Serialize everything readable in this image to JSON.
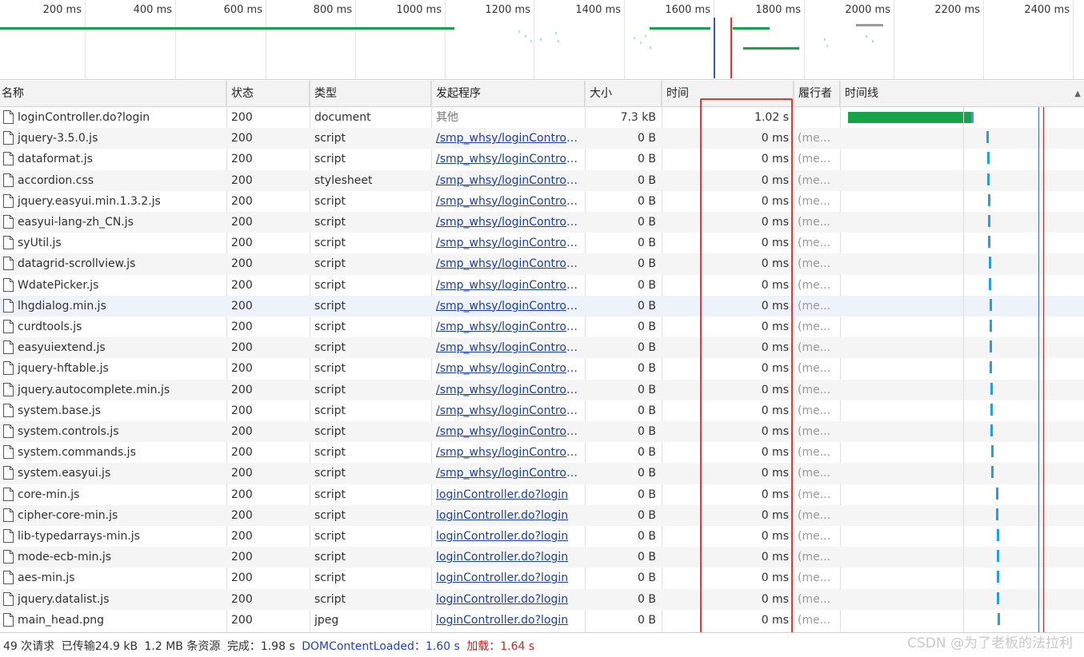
{
  "overview": {
    "ticks": [
      "200 ms",
      "400 ms",
      "600 ms",
      "800 ms",
      "1000 ms",
      "1200 ms",
      "1400 ms",
      "1600 ms",
      "1800 ms",
      "2000 ms",
      "2200 ms",
      "2400 ms"
    ]
  },
  "columns": {
    "name": "名称",
    "status": "状态",
    "type": "类型",
    "initiator": "发起程序",
    "size": "大小",
    "time": "时间",
    "fulfilled_by": "履行者",
    "waterfall": "时间线"
  },
  "rows": [
    {
      "name": "loginController.do?login",
      "status": "200",
      "type": "document",
      "initiator": "其他",
      "initiator_link": false,
      "size": "7.3 kB",
      "time": "1.02 s",
      "perf": ""
    },
    {
      "name": "jquery-3.5.0.js",
      "status": "200",
      "type": "script",
      "initiator": "/smp_whsy/loginControll...",
      "initiator_link": true,
      "size": "0 B",
      "time": "0 ms",
      "perf": "(me..."
    },
    {
      "name": "dataformat.js",
      "status": "200",
      "type": "script",
      "initiator": "/smp_whsy/loginControll...",
      "initiator_link": true,
      "size": "0 B",
      "time": "0 ms",
      "perf": "(me..."
    },
    {
      "name": "accordion.css",
      "status": "200",
      "type": "stylesheet",
      "initiator": "/smp_whsy/loginControll...",
      "initiator_link": true,
      "size": "0 B",
      "time": "0 ms",
      "perf": "(me..."
    },
    {
      "name": "jquery.easyui.min.1.3.2.js",
      "status": "200",
      "type": "script",
      "initiator": "/smp_whsy/loginControll...",
      "initiator_link": true,
      "size": "0 B",
      "time": "0 ms",
      "perf": "(me..."
    },
    {
      "name": "easyui-lang-zh_CN.js",
      "status": "200",
      "type": "script",
      "initiator": "/smp_whsy/loginControll...",
      "initiator_link": true,
      "size": "0 B",
      "time": "0 ms",
      "perf": "(me..."
    },
    {
      "name": "syUtil.js",
      "status": "200",
      "type": "script",
      "initiator": "/smp_whsy/loginControll...",
      "initiator_link": true,
      "size": "0 B",
      "time": "0 ms",
      "perf": "(me..."
    },
    {
      "name": "datagrid-scrollview.js",
      "status": "200",
      "type": "script",
      "initiator": "/smp_whsy/loginControll...",
      "initiator_link": true,
      "size": "0 B",
      "time": "0 ms",
      "perf": "(me..."
    },
    {
      "name": "WdatePicker.js",
      "status": "200",
      "type": "script",
      "initiator": "/smp_whsy/loginControll...",
      "initiator_link": true,
      "size": "0 B",
      "time": "0 ms",
      "perf": "(me..."
    },
    {
      "name": "lhgdialog.min.js",
      "status": "200",
      "type": "script",
      "initiator": "/smp_whsy/loginControll...",
      "initiator_link": true,
      "size": "0 B",
      "time": "0 ms",
      "perf": "(me..."
    },
    {
      "name": "curdtools.js",
      "status": "200",
      "type": "script",
      "initiator": "/smp_whsy/loginControll...",
      "initiator_link": true,
      "size": "0 B",
      "time": "0 ms",
      "perf": "(me..."
    },
    {
      "name": "easyuiextend.js",
      "status": "200",
      "type": "script",
      "initiator": "/smp_whsy/loginControll...",
      "initiator_link": true,
      "size": "0 B",
      "time": "0 ms",
      "perf": "(me..."
    },
    {
      "name": "jquery-hftable.js",
      "status": "200",
      "type": "script",
      "initiator": "/smp_whsy/loginControll...",
      "initiator_link": true,
      "size": "0 B",
      "time": "0 ms",
      "perf": "(me..."
    },
    {
      "name": "jquery.autocomplete.min.js",
      "status": "200",
      "type": "script",
      "initiator": "/smp_whsy/loginControll...",
      "initiator_link": true,
      "size": "0 B",
      "time": "0 ms",
      "perf": "(me..."
    },
    {
      "name": "system.base.js",
      "status": "200",
      "type": "script",
      "initiator": "/smp_whsy/loginControll...",
      "initiator_link": true,
      "size": "0 B",
      "time": "0 ms",
      "perf": "(me..."
    },
    {
      "name": "system.controls.js",
      "status": "200",
      "type": "script",
      "initiator": "/smp_whsy/loginControll...",
      "initiator_link": true,
      "size": "0 B",
      "time": "0 ms",
      "perf": "(me..."
    },
    {
      "name": "system.commands.js",
      "status": "200",
      "type": "script",
      "initiator": "/smp_whsy/loginControll...",
      "initiator_link": true,
      "size": "0 B",
      "time": "0 ms",
      "perf": "(me..."
    },
    {
      "name": "system.easyui.js",
      "status": "200",
      "type": "script",
      "initiator": "/smp_whsy/loginControll...",
      "initiator_link": true,
      "size": "0 B",
      "time": "0 ms",
      "perf": "(me..."
    },
    {
      "name": "core-min.js",
      "status": "200",
      "type": "script",
      "initiator": "loginController.do?login",
      "initiator_link": true,
      "size": "0 B",
      "time": "0 ms",
      "perf": "(me..."
    },
    {
      "name": "cipher-core-min.js",
      "status": "200",
      "type": "script",
      "initiator": "loginController.do?login",
      "initiator_link": true,
      "size": "0 B",
      "time": "0 ms",
      "perf": "(me..."
    },
    {
      "name": "lib-typedarrays-min.js",
      "status": "200",
      "type": "script",
      "initiator": "loginController.do?login",
      "initiator_link": true,
      "size": "0 B",
      "time": "0 ms",
      "perf": "(me..."
    },
    {
      "name": "mode-ecb-min.js",
      "status": "200",
      "type": "script",
      "initiator": "loginController.do?login",
      "initiator_link": true,
      "size": "0 B",
      "time": "0 ms",
      "perf": "(me..."
    },
    {
      "name": "aes-min.js",
      "status": "200",
      "type": "script",
      "initiator": "loginController.do?login",
      "initiator_link": true,
      "size": "0 B",
      "time": "0 ms",
      "perf": "(me..."
    },
    {
      "name": "jquery.datalist.js",
      "status": "200",
      "type": "script",
      "initiator": "loginController.do?login",
      "initiator_link": true,
      "size": "0 B",
      "time": "0 ms",
      "perf": "(me..."
    },
    {
      "name": "main_head.png",
      "status": "200",
      "type": "jpeg",
      "initiator": "loginController.do?login",
      "initiator_link": true,
      "size": "0 B",
      "time": "0 ms",
      "perf": "(me..."
    }
  ],
  "status_bar": {
    "requests": "49 次请求",
    "transferred": "已传输24.9 kB",
    "resources": "1.2 MB 条资源",
    "finish": "完成：1.98 s",
    "dcl": "DOMContentLoaded：1.60 s",
    "load": "加载：1.64 s"
  },
  "watermark": "CSDN @为了老板的法拉利",
  "colors": {
    "bar_green": "#16a34a",
    "dcl_line": "#2340c0",
    "load_line": "#c62828",
    "annotation": "#e53935"
  }
}
